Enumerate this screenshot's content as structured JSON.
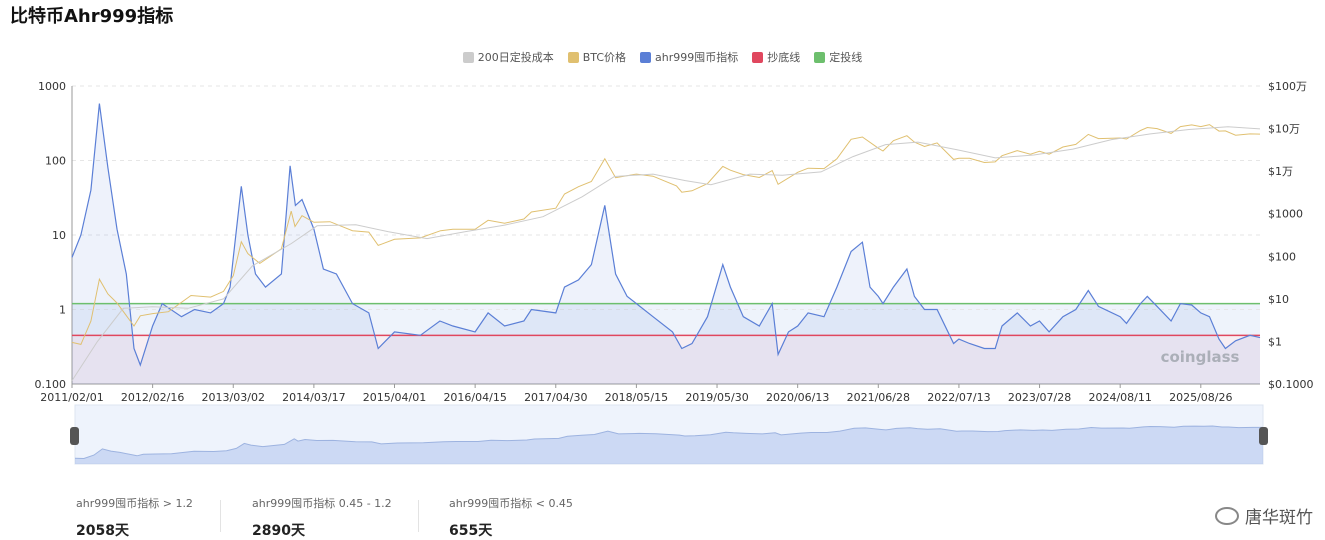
{
  "page_title": "比特币Ahr999指标",
  "legend": [
    {
      "label": "200日定投成本",
      "color": "#cccccc"
    },
    {
      "label": "BTC价格",
      "color": "#e0c070"
    },
    {
      "label": "ahr999囤币指标",
      "color": "#5b7fd6"
    },
    {
      "label": "抄底线",
      "color": "#e0475e"
    },
    {
      "label": "定投线",
      "color": "#6dbf6d"
    }
  ],
  "chart_data": {
    "type": "line",
    "title": "比特币Ahr999指标",
    "x_tick_labels": [
      "2011/02/01",
      "2012/02/16",
      "2013/03/02",
      "2014/03/17",
      "2015/04/01",
      "2016/04/15",
      "2017/04/30",
      "2018/05/15",
      "2019/05/30",
      "2020/06/13",
      "2021/06/28",
      "2022/07/13",
      "2023/07/28",
      "2024/08/11",
      "2025/08/26"
    ],
    "x_range": [
      "2011/02/01",
      "2026/06/01"
    ],
    "y_left": {
      "scale": "log",
      "range": [
        0.1,
        1000
      ],
      "tick_labels": [
        "1000",
        "100",
        "10",
        "1",
        "0.100"
      ]
    },
    "y_right": {
      "scale": "log",
      "range": [
        0.1,
        1000000
      ],
      "tick_labels": [
        "$100万",
        "$10万",
        "$1万",
        "$1000",
        "$100",
        "$10",
        "$1",
        "$0.1000"
      ]
    },
    "series": [
      {
        "name": "ahr999囤币指标",
        "axis": "left",
        "color": "#5b7fd6",
        "points": [
          [
            "2011/02/01",
            5
          ],
          [
            "2011/03/15",
            10
          ],
          [
            "2011/05/01",
            40
          ],
          [
            "2011/06/10",
            580
          ],
          [
            "2011/07/20",
            80
          ],
          [
            "2011/09/01",
            12
          ],
          [
            "2011/10/15",
            3
          ],
          [
            "2011/11/20",
            0.3
          ],
          [
            "2011/12/20",
            0.18
          ],
          [
            "2012/02/16",
            0.6
          ],
          [
            "2012/04/01",
            1.2
          ],
          [
            "2012/07/01",
            0.8
          ],
          [
            "2012/09/01",
            1.0
          ],
          [
            "2012/11/15",
            0.9
          ],
          [
            "2013/01/15",
            1.2
          ],
          [
            "2013/02/15",
            2
          ],
          [
            "2013/03/02",
            5
          ],
          [
            "2013/04/09",
            45
          ],
          [
            "2013/05/10",
            10
          ],
          [
            "2013/06/15",
            3
          ],
          [
            "2013/08/01",
            2
          ],
          [
            "2013/10/15",
            3
          ],
          [
            "2013/11/25",
            85
          ],
          [
            "2013/12/20",
            25
          ],
          [
            "2014/01/20",
            30
          ],
          [
            "2014/03/17",
            12
          ],
          [
            "2014/05/01",
            3.5
          ],
          [
            "2014/07/01",
            3
          ],
          [
            "2014/09/15",
            1.2
          ],
          [
            "2014/12/01",
            0.9
          ],
          [
            "2015/01/14",
            0.3
          ],
          [
            "2015/04/01",
            0.5
          ],
          [
            "2015/08/01",
            0.45
          ],
          [
            "2015/11/01",
            0.7
          ],
          [
            "2016/01/01",
            0.6
          ],
          [
            "2016/04/15",
            0.5
          ],
          [
            "2016/06/15",
            0.9
          ],
          [
            "2016/09/01",
            0.6
          ],
          [
            "2016/12/01",
            0.7
          ],
          [
            "2017/01/05",
            1.0
          ],
          [
            "2017/04/30",
            0.9
          ],
          [
            "2017/06/10",
            2
          ],
          [
            "2017/08/15",
            2.5
          ],
          [
            "2017/10/15",
            4
          ],
          [
            "2017/12/17",
            25
          ],
          [
            "2018/02/06",
            3
          ],
          [
            "2018/04/01",
            1.5
          ],
          [
            "2018/05/15",
            1.2
          ],
          [
            "2018/08/01",
            0.8
          ],
          [
            "2018/11/01",
            0.5
          ],
          [
            "2018/12/15",
            0.3
          ],
          [
            "2019/02/01",
            0.35
          ],
          [
            "2019/04/15",
            0.8
          ],
          [
            "2019/06/26",
            4
          ],
          [
            "2019/08/01",
            2
          ],
          [
            "2019/10/01",
            0.8
          ],
          [
            "2019/12/15",
            0.6
          ],
          [
            "2020/02/14",
            1.2
          ],
          [
            "2020/03/13",
            0.25
          ],
          [
            "2020/05/01",
            0.5
          ],
          [
            "2020/06/13",
            0.6
          ],
          [
            "2020/08/01",
            0.9
          ],
          [
            "2020/10/15",
            0.8
          ],
          [
            "2020/12/15",
            2
          ],
          [
            "2021/02/20",
            6
          ],
          [
            "2021/04/14",
            8
          ],
          [
            "2021/05/20",
            2
          ],
          [
            "2021/06/28",
            1.5
          ],
          [
            "2021/07/20",
            1.2
          ],
          [
            "2021/09/07",
            2
          ],
          [
            "2021/11/10",
            3.5
          ],
          [
            "2021/12/15",
            1.5
          ],
          [
            "2022/02/01",
            1.0
          ],
          [
            "2022/04/01",
            1.0
          ],
          [
            "2022/06/18",
            0.35
          ],
          [
            "2022/07/13",
            0.4
          ],
          [
            "2022/09/01",
            0.35
          ],
          [
            "2022/11/10",
            0.3
          ],
          [
            "2022/12/31",
            0.3
          ],
          [
            "2023/02/01",
            0.6
          ],
          [
            "2023/04/14",
            0.9
          ],
          [
            "2023/06/15",
            0.6
          ],
          [
            "2023/07/28",
            0.7
          ],
          [
            "2023/09/11",
            0.5
          ],
          [
            "2023/11/15",
            0.8
          ],
          [
            "2024/01/15",
            1.0
          ],
          [
            "2024/03/14",
            1.8
          ],
          [
            "2024/05/01",
            1.1
          ],
          [
            "2024/08/11",
            0.8
          ],
          [
            "2024/09/10",
            0.65
          ],
          [
            "2024/11/15",
            1.2
          ],
          [
            "2024/12/17",
            1.5
          ],
          [
            "2025/02/01",
            1.1
          ],
          [
            "2025/04/08",
            0.7
          ],
          [
            "2025/05/22",
            1.2
          ],
          [
            "2025/07/14",
            1.15
          ],
          [
            "2025/08/26",
            0.9
          ],
          [
            "2025/10/06",
            0.8
          ],
          [
            "2025/11/20",
            0.4
          ],
          [
            "2025/12/20",
            0.3
          ],
          [
            "2026/02/06",
            0.38
          ],
          [
            "2026/04/15",
            0.45
          ],
          [
            "2026/06/01",
            0.42
          ]
        ]
      },
      {
        "name": "BTC价格",
        "axis": "right",
        "color": "#e0c070",
        "points": [
          [
            "2011/02/01",
            0.95
          ],
          [
            "2011/03/15",
            0.85
          ],
          [
            "2011/05/01",
            3
          ],
          [
            "2011/06/10",
            29
          ],
          [
            "2011/07/20",
            13
          ],
          [
            "2011/09/01",
            8
          ],
          [
            "2011/11/20",
            2.3
          ],
          [
            "2011/12/20",
            4
          ],
          [
            "2012/02/16",
            4.5
          ],
          [
            "2012/05/01",
            5
          ],
          [
            "2012/08/15",
            12
          ],
          [
            "2012/11/15",
            11
          ],
          [
            "2013/01/15",
            15
          ],
          [
            "2013/03/02",
            35
          ],
          [
            "2013/04/09",
            220
          ],
          [
            "2013/05/10",
            115
          ],
          [
            "2013/07/05",
            68
          ],
          [
            "2013/10/15",
            150
          ],
          [
            "2013/11/30",
            1150
          ],
          [
            "2013/12/18",
            500
          ],
          [
            "2014/01/20",
            900
          ],
          [
            "2014/03/17",
            630
          ],
          [
            "2014/06/01",
            650
          ],
          [
            "2014/09/15",
            400
          ],
          [
            "2014/12/01",
            370
          ],
          [
            "2015/01/14",
            180
          ],
          [
            "2015/04/01",
            250
          ],
          [
            "2015/08/01",
            270
          ],
          [
            "2015/11/04",
            400
          ],
          [
            "2016/01/01",
            430
          ],
          [
            "2016/04/15",
            430
          ],
          [
            "2016/06/15",
            700
          ],
          [
            "2016/09/01",
            600
          ],
          [
            "2016/12/01",
            750
          ],
          [
            "2017/01/05",
            1100
          ],
          [
            "2017/04/30",
            1350
          ],
          [
            "2017/06/10",
            2900
          ],
          [
            "2017/08/15",
            4300
          ],
          [
            "2017/10/15",
            5700
          ],
          [
            "2017/12/17",
            19500
          ],
          [
            "2018/02/06",
            7000
          ],
          [
            "2018/05/15",
            8500
          ],
          [
            "2018/08/01",
            7600
          ],
          [
            "2018/11/20",
            4500
          ],
          [
            "2018/12/15",
            3200
          ],
          [
            "2019/02/01",
            3450
          ],
          [
            "2019/04/15",
            5100
          ],
          [
            "2019/06/26",
            12900
          ],
          [
            "2019/08/01",
            10500
          ],
          [
            "2019/10/01",
            8300
          ],
          [
            "2019/12/15",
            7100
          ],
          [
            "2020/02/14",
            10300
          ],
          [
            "2020/03/13",
            4900
          ],
          [
            "2020/06/13",
            9400
          ],
          [
            "2020/08/01",
            11700
          ],
          [
            "2020/10/15",
            11500
          ],
          [
            "2020/12/15",
            19500
          ],
          [
            "2021/02/20",
            56000
          ],
          [
            "2021/04/14",
            63500
          ],
          [
            "2021/06/28",
            34500
          ],
          [
            "2021/07/20",
            29800
          ],
          [
            "2021/09/07",
            52000
          ],
          [
            "2021/11/10",
            68000
          ],
          [
            "2021/12/15",
            48000
          ],
          [
            "2022/02/01",
            38000
          ],
          [
            "2022/04/01",
            46000
          ],
          [
            "2022/06/18",
            18900
          ],
          [
            "2022/07/13",
            20000
          ],
          [
            "2022/09/01",
            20000
          ],
          [
            "2022/11/10",
            16000
          ],
          [
            "2022/12/31",
            16500
          ],
          [
            "2023/02/01",
            23000
          ],
          [
            "2023/04/14",
            30300
          ],
          [
            "2023/06/15",
            25000
          ],
          [
            "2023/07/28",
            29300
          ],
          [
            "2023/09/11",
            25000
          ],
          [
            "2023/11/15",
            37000
          ],
          [
            "2024/01/15",
            42500
          ],
          [
            "2024/03/14",
            73000
          ],
          [
            "2024/05/01",
            58000
          ],
          [
            "2024/08/11",
            60000
          ],
          [
            "2024/09/10",
            57000
          ],
          [
            "2024/11/15",
            90000
          ],
          [
            "2024/12/17",
            106000
          ],
          [
            "2025/02/01",
            100000
          ],
          [
            "2025/04/08",
            77000
          ],
          [
            "2025/05/22",
            111000
          ],
          [
            "2025/07/14",
            122000
          ],
          [
            "2025/08/26",
            111000
          ],
          [
            "2025/10/06",
            124000
          ],
          [
            "2025/11/20",
            87000
          ],
          [
            "2025/12/20",
            88000
          ],
          [
            "2026/02/06",
            70000
          ],
          [
            "2026/04/15",
            75000
          ],
          [
            "2026/06/01",
            74000
          ]
        ]
      },
      {
        "name": "200日定投成本",
        "axis": "right",
        "color": "#cccccc",
        "points": [
          [
            "2011/02/01",
            0.12
          ],
          [
            "2011/06/01",
            1
          ],
          [
            "2011/10/01",
            6
          ],
          [
            "2012/02/16",
            6.5
          ],
          [
            "2012/08/01",
            6
          ],
          [
            "2013/01/15",
            10
          ],
          [
            "2013/06/01",
            60
          ],
          [
            "2013/12/01",
            200
          ],
          [
            "2014/04/01",
            520
          ],
          [
            "2014/10/01",
            550
          ],
          [
            "2015/03/01",
            380
          ],
          [
            "2015/09/01",
            260
          ],
          [
            "2016/03/01",
            380
          ],
          [
            "2016/09/01",
            540
          ],
          [
            "2017/03/01",
            850
          ],
          [
            "2017/09/01",
            2500
          ],
          [
            "2018/02/01",
            7500
          ],
          [
            "2018/08/01",
            8500
          ],
          [
            "2019/01/01",
            6000
          ],
          [
            "2019/05/01",
            4800
          ],
          [
            "2019/11/01",
            8500
          ],
          [
            "2020/04/01",
            8000
          ],
          [
            "2020/10/01",
            9600
          ],
          [
            "2021/03/01",
            22000
          ],
          [
            "2021/08/01",
            42000
          ],
          [
            "2022/01/01",
            48000
          ],
          [
            "2022/07/01",
            32000
          ],
          [
            "2023/01/01",
            20500
          ],
          [
            "2023/07/01",
            24000
          ],
          [
            "2024/01/01",
            33000
          ],
          [
            "2024/07/01",
            55000
          ],
          [
            "2025/01/01",
            75000
          ],
          [
            "2025/07/01",
            95000
          ],
          [
            "2026/01/01",
            110000
          ],
          [
            "2026/06/01",
            98000
          ]
        ]
      },
      {
        "name": "抄底线",
        "axis": "left",
        "color": "#e0475e",
        "constant": 0.45
      },
      {
        "name": "定投线",
        "axis": "left",
        "color": "#6dbf6d",
        "constant": 1.2
      }
    ],
    "legend_position": "top-center",
    "grid": "horizontal-dashed"
  },
  "stats": [
    {
      "label": "ahr999囤币指标 > 1.2",
      "value": "2058天"
    },
    {
      "label": "ahr999囤币指标 0.45 - 1.2",
      "value": "2890天"
    },
    {
      "label": "ahr999囤币指标 < 0.45",
      "value": "655天"
    }
  ],
  "chart_watermark_text": "coinglass",
  "watermark": "唐华斑竹"
}
